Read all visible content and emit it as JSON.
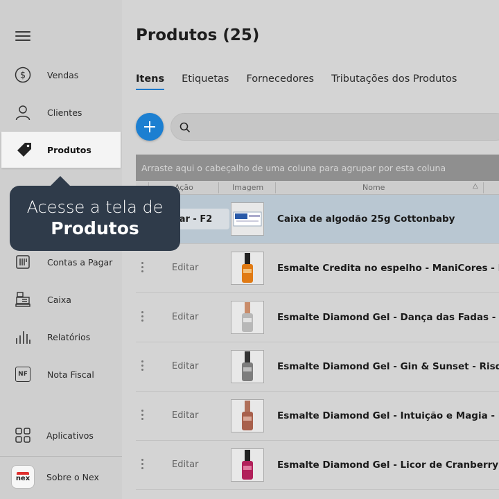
{
  "sidebar": {
    "items": [
      {
        "label": "Vendas",
        "icon": "dollar-circle-icon"
      },
      {
        "label": "Clientes",
        "icon": "user-icon"
      },
      {
        "label": "Produtos",
        "icon": "tag-icon"
      },
      {
        "label": "Contas a Pagar",
        "icon": "bill-icon"
      },
      {
        "label": "Caixa",
        "icon": "cash-register-icon"
      },
      {
        "label": "Relatórios",
        "icon": "bar-chart-icon"
      },
      {
        "label": "Nota Fiscal",
        "icon": "nf-icon"
      },
      {
        "label": "Aplicativos",
        "icon": "apps-grid-icon"
      },
      {
        "label": "Sobre o Nex",
        "icon": "nex-logo"
      }
    ],
    "nf_icon_text": "NF",
    "logo_text": "nex"
  },
  "main": {
    "title": "Produtos (25)",
    "tabs": [
      {
        "label": "Itens",
        "active": true
      },
      {
        "label": "Etiquetas"
      },
      {
        "label": "Fornecedores"
      },
      {
        "label": "Tributações dos Produtos"
      }
    ],
    "search": {
      "placeholder": "",
      "value": ""
    },
    "group_hint": "Arraste aqui o cabeçalho de uma coluna para agrupar por esta coluna",
    "columns": [
      "Ação",
      "Imagem",
      "Nome"
    ],
    "selected_action_label": "ar - F2",
    "edit_label": "Editar",
    "rows": [
      {
        "name": "Caixa de algodão 25g Cottonbaby",
        "selected": true
      },
      {
        "name": "Esmalte Credita no espelho - ManiCores - R"
      },
      {
        "name": "Esmalte Diamond Gel - Dança das Fadas - R"
      },
      {
        "name": "Esmalte Diamond Gel - Gin & Sunset - Risqu"
      },
      {
        "name": "Esmalte Diamond Gel - Intuição e Magia - Ri"
      },
      {
        "name": "Esmalte Diamond Gel - Licor de Cranberry -"
      }
    ]
  },
  "tooltip": {
    "line1": "Acesse a tela de",
    "line2": "Produtos"
  },
  "colors": {
    "accent": "#1c7fd1",
    "tooltip_bg": "#2f3b4a",
    "selected_row": "#b9c7d2"
  }
}
